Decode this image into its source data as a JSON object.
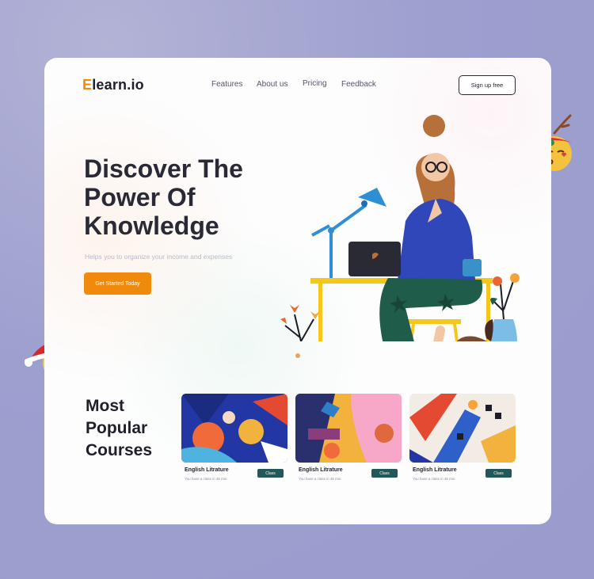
{
  "brand": {
    "logo_first": "E",
    "logo_rest": "learn.io"
  },
  "nav": {
    "items": [
      "Features",
      "About us",
      "Pricing",
      "Feedback"
    ],
    "signup_label": "Sign up free"
  },
  "hero": {
    "title_lines": [
      "Discover The",
      "Power Of",
      "Knowledge"
    ],
    "subtitle": "Helps you to organize your income and expenses",
    "cta_label": "Get Started Today"
  },
  "courses": {
    "title_lines": [
      "Most",
      "Popular",
      "Courses"
    ],
    "items": [
      {
        "name": "English Litrature",
        "meta": "You have a class in 45 min",
        "button": "Class"
      },
      {
        "name": "English Litrature",
        "meta": "You have a class in 45 min",
        "button": "Class"
      },
      {
        "name": "English Litrature",
        "meta": "You have a class in 45 min",
        "button": "Class"
      }
    ]
  },
  "colors": {
    "accent": "#f08a0d",
    "button_dark": "#235858",
    "background": "#9d9fcf"
  },
  "icons": [
    "reindeer-emoji-icon",
    "santa-hat-emoji-icon"
  ]
}
